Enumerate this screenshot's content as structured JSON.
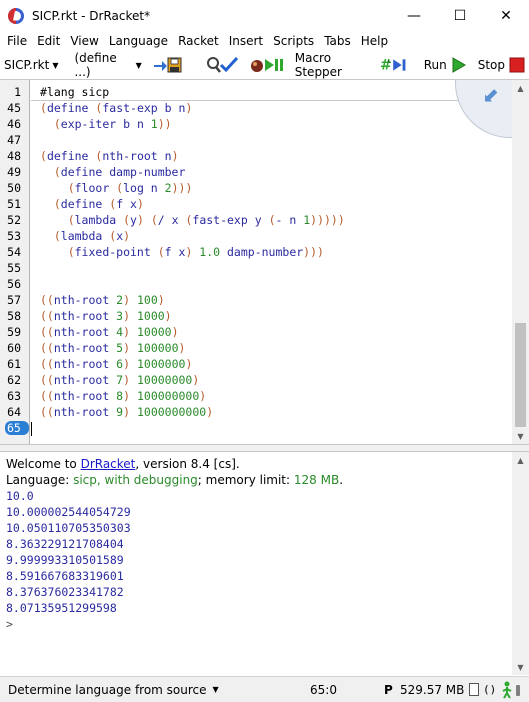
{
  "window": {
    "title": "SICP.rkt - DrRacket*",
    "minimize": "—",
    "maximize": "☐",
    "close": "✕"
  },
  "menu": [
    "File",
    "Edit",
    "View",
    "Language",
    "Racket",
    "Insert",
    "Scripts",
    "Tabs",
    "Help"
  ],
  "toolbar": {
    "file_dropdown": "SICP.rkt",
    "define_dropdown": "(define ...)",
    "macro_stepper": "Macro Stepper",
    "run": "Run",
    "stop": "Stop"
  },
  "editor": {
    "line_numbers": [
      "1",
      "45",
      "46",
      "47",
      "48",
      "49",
      "50",
      "51",
      "52",
      "53",
      "54",
      "55",
      "56",
      "57",
      "58",
      "59",
      "60",
      "61",
      "62",
      "63",
      "64",
      "65"
    ],
    "current_line": "65",
    "lang_line": "#lang sicp",
    "code": [
      {
        "p1": "(",
        "s": "define ",
        "p2": "(",
        "s2": "fast-exp b n",
        "p3": ")",
        "rest": ""
      },
      {
        "p1": "  (",
        "s": "exp-iter b n ",
        "n": "1",
        "p2": "))"
      },
      {
        "blank": true
      },
      {
        "p1": "(",
        "s": "define ",
        "p2": "(",
        "s2": "nth-root n",
        "p3": ")"
      },
      {
        "p1": "  (",
        "s": "define damp-number"
      },
      {
        "p1": "    (",
        "s": "floor ",
        "p2": "(",
        "s2": "log n ",
        "n": "2",
        "p3": ")))"
      },
      {
        "p1": "  (",
        "s": "define ",
        "p2": "(",
        "s2": "f x",
        "p3": ")"
      },
      {
        "p1": "    (",
        "s": "lambda ",
        "p2": "(",
        "s2": "y",
        "p3": ") (",
        "s3": "/ x ",
        "p4": "(",
        "s4": "fast-exp y ",
        "p5": "(",
        "s5": "- n ",
        "n": "1",
        "p6": ")))))"
      },
      {
        "p1": "  (",
        "s": "lambda ",
        "p2": "(",
        "s2": "x",
        "p3": ")"
      },
      {
        "p1": "    (",
        "s": "fixed-point ",
        "p2": "(",
        "s2": "f x",
        "p3": ") ",
        "n": "1.0",
        "s3": " damp-number",
        "p4": ")))"
      },
      {
        "blank": true
      },
      {
        "blank": true
      },
      {
        "p1": "((",
        "s": "nth-root ",
        "n": "2",
        "p2": ") ",
        "n2": "100",
        "p3": ")"
      },
      {
        "p1": "((",
        "s": "nth-root ",
        "n": "3",
        "p2": ") ",
        "n2": "1000",
        "p3": ")"
      },
      {
        "p1": "((",
        "s": "nth-root ",
        "n": "4",
        "p2": ") ",
        "n2": "10000",
        "p3": ")"
      },
      {
        "p1": "((",
        "s": "nth-root ",
        "n": "5",
        "p2": ") ",
        "n2": "100000",
        "p3": ")"
      },
      {
        "p1": "((",
        "s": "nth-root ",
        "n": "6",
        "p2": ") ",
        "n2": "1000000",
        "p3": ")"
      },
      {
        "p1": "((",
        "s": "nth-root ",
        "n": "7",
        "p2": ") ",
        "n2": "10000000",
        "p3": ")"
      },
      {
        "p1": "((",
        "s": "nth-root ",
        "n": "8",
        "p2": ") ",
        "n2": "100000000",
        "p3": ")"
      },
      {
        "p1": "((",
        "s": "nth-root ",
        "n": "9",
        "p2": ") ",
        "n2": "1000000000",
        "p3": ")"
      }
    ]
  },
  "repl": {
    "welcome_prefix": "Welcome to ",
    "welcome_link": "DrRacket",
    "welcome_suffix": ", version 8.4 [cs].",
    "language_prefix": "Language: ",
    "language_name": "sicp, with debugging",
    "language_mid": "; memory limit: ",
    "memory_limit": "128 MB",
    "language_end": ".",
    "outputs": [
      "10.0",
      "10.000002544054729",
      "10.050110705350303",
      "8.363229121708404",
      "9.999993310501589",
      "8.591667683319601",
      "8.376376023341782",
      "8.07135951299598"
    ],
    "prompt": ">"
  },
  "status": {
    "language_selector": "Determine language from source",
    "position": "65:0",
    "p_indicator": "P",
    "memory": "529.57 MB",
    "parens": "()"
  },
  "icons": {
    "app": "drracket-logo-icon",
    "save": "save-icon",
    "check_syntax": "check-syntax-icon",
    "debug": "debug-icon",
    "macro_stepper": "macro-stepper-icon",
    "run": "run-icon",
    "stop": "stop-icon"
  },
  "colors": {
    "paren": "#b45a2b",
    "symbol": "#2a2aa0",
    "number": "#2a8a2a",
    "current_line": "#2a7fd4",
    "run_green": "#2ea82e",
    "stop_red": "#d82020"
  }
}
